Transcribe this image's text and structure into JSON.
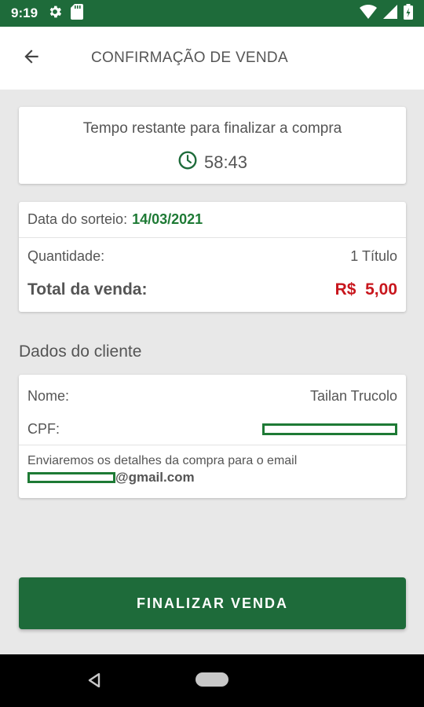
{
  "status_bar": {
    "time": "9:19",
    "icons": [
      "gear-icon",
      "sd-card-icon",
      "wifi-icon",
      "signal-icon",
      "battery-icon"
    ]
  },
  "app_bar": {
    "title": "CONFIRMAÇÃO DE VENDA",
    "back_icon": "arrow-left-icon"
  },
  "timer": {
    "label": "Tempo restante para finalizar a compra",
    "value": "58:43",
    "icon": "clock-icon"
  },
  "sale": {
    "draw_date_label": "Data do sorteio:",
    "draw_date": "14/03/2021",
    "quantity_label": "Quantidade:",
    "quantity_value": "1 Título",
    "total_label": "Total da venda:",
    "total_value": "R$  5,00"
  },
  "client": {
    "section_title": "Dados do cliente",
    "name_label": "Nome:",
    "name_value": "Tailan Trucolo",
    "cpf_label": "CPF:",
    "email_note": "Enviaremos os detalhes da compra para o email",
    "email_domain": "@gmail.com"
  },
  "actions": {
    "finish_label": "FINALIZAR VENDA"
  },
  "colors": {
    "primary_green": "#1e6b3a",
    "accent_green": "#1e7a35",
    "price_red": "#c8161d",
    "background": "#e8e8e8"
  },
  "nav": {
    "icons": [
      "back-triangle-icon",
      "home-pill-icon"
    ]
  }
}
